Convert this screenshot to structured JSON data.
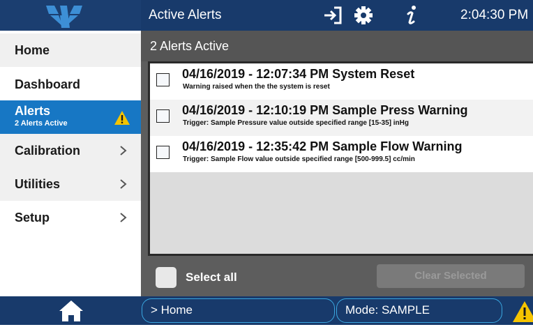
{
  "header": {
    "title": "Active Alerts",
    "clock": "2:04:30 PM",
    "icons": [
      "logo-icon",
      "logout-icon",
      "gear-icon",
      "info-icon"
    ]
  },
  "sidebar": {
    "items": [
      {
        "label": "Home",
        "has_chevron": false
      },
      {
        "label": "Dashboard",
        "has_chevron": false
      },
      {
        "label": "Alerts",
        "sublabel": "2 Alerts Active",
        "active": true,
        "icon": "warning-icon"
      },
      {
        "label": "Calibration",
        "has_chevron": true
      },
      {
        "label": "Utilities",
        "has_chevron": true
      },
      {
        "label": "Setup",
        "has_chevron": true
      }
    ]
  },
  "main": {
    "header": "2 Alerts Active",
    "alerts": [
      {
        "title": "04/16/2019 - 12:07:34 PM System Reset",
        "description": "Warning raised when the the system is reset",
        "checked": false
      },
      {
        "title": "04/16/2019 - 12:10:19 PM Sample Press Warning",
        "description": "Trigger: Sample Pressure value outside specified range [15-35] inHg",
        "checked": false
      },
      {
        "title": "04/16/2019 - 12:35:42 PM Sample Flow Warning",
        "description": "Trigger: Sample Flow value outside specified range [500-999.5] cc/min",
        "checked": false
      }
    ],
    "select_all": "Select all",
    "clear_button": "Clear Selected"
  },
  "footer": {
    "breadcrumb": "> Home",
    "mode": "Mode: SAMPLE",
    "icons": [
      "home-icon",
      "warning-icon"
    ]
  },
  "colors": {
    "topbar": "#183a6b",
    "active_nav": "#1777c4",
    "nav_alt": "#f0f0f0",
    "main_bg": "#5d5d5d",
    "accent_border": "#3aa7e0",
    "warning": "#f5c400"
  }
}
